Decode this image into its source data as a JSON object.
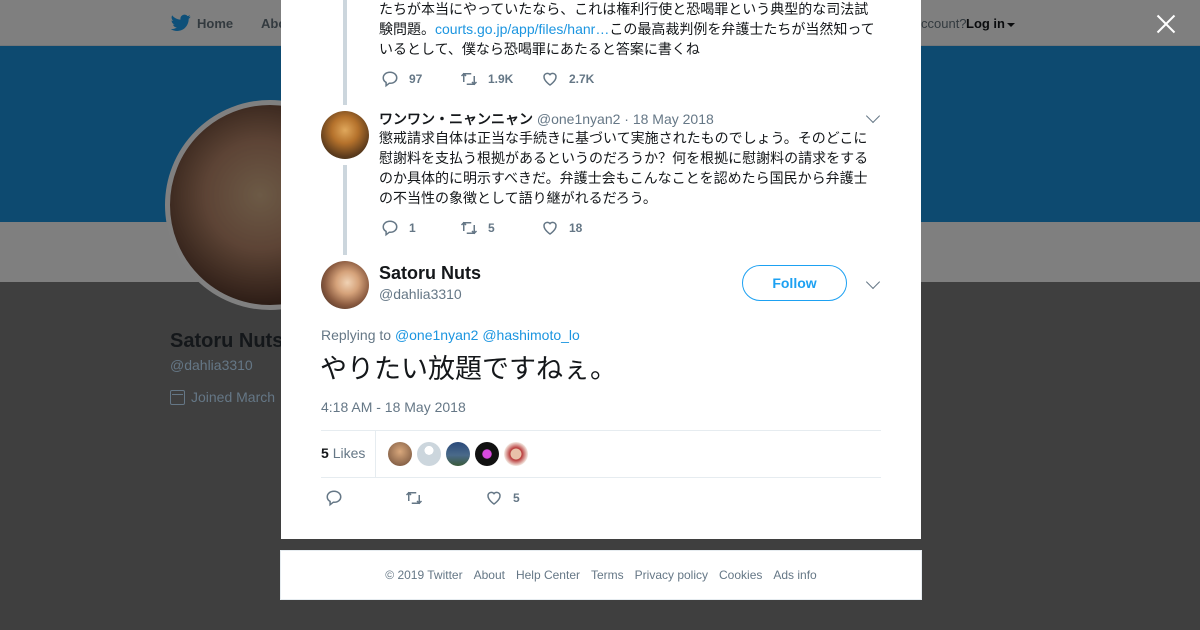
{
  "topnav": {
    "home_label": "Home",
    "about_label": "Abo",
    "account_prompt": "ccount?",
    "login_label": "Log in"
  },
  "background_profile": {
    "name": "Satoru Nuts",
    "handle": "@dahlia3310",
    "joined": "Joined March"
  },
  "thread": {
    "prev1": {
      "text_before_link": "たちが本当にやっていたなら、これは権利行使と恐喝罪という典型的な司法試験問題。",
      "link": "courts.go.jp/app/files/hanr…",
      "text_after_link": "この最高裁判例を弁護士たちが当然知っているとして、僕なら恐喝罪にあたると答案に書くね",
      "replies": "97",
      "retweets": "1.9K",
      "likes": "2.7K"
    },
    "prev2": {
      "name": "ワンワン・ニャンニャン",
      "handle": "@one1nyan2",
      "date": "· 18 May 2018",
      "text": "懲戒請求自体は正当な手続きに基づいて実施されたものでしょう。そのどこに慰謝料を支払う根拠があるというのだろうか？何を根拠に慰謝料の請求をするのか具体的に明示すべきだ。弁護士会もこんなことを認めたら国民から弁護士の不当性の象徴として語り継がれるだろう。",
      "replies": "1",
      "retweets": "5",
      "likes": "18"
    },
    "main": {
      "name": "Satoru Nuts",
      "handle": "@dahlia3310",
      "follow_label": "Follow",
      "replying_prefix": "Replying to",
      "replying_to_1": "@one1nyan2",
      "replying_to_2": "@hashimoto_lo",
      "text": "やりたい放題ですねぇ。",
      "timestamp": "4:18 AM - 18 May 2018",
      "likes_count": "5",
      "likes_label": "Likes",
      "likes_action_count": "5"
    }
  },
  "footer": {
    "copyright": "© 2019 Twitter",
    "links": [
      "About",
      "Help Center",
      "Terms",
      "Privacy policy",
      "Cookies",
      "Ads info"
    ]
  },
  "colors": {
    "brand": "#1da1f2",
    "link": "#1b95e0",
    "banner": "#1b95e0",
    "secondary_text": "#657786"
  }
}
